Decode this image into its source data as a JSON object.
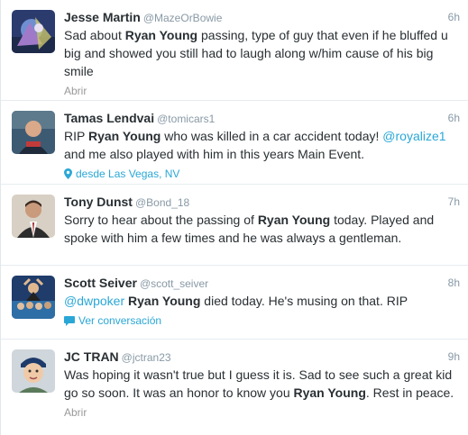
{
  "tweets": [
    {
      "fullname": "Jesse Martin",
      "username": "@MazeOrBowie",
      "time": "6h",
      "text_parts": {
        "p0": "Sad about ",
        "b0": "Ryan Young",
        "p1": " passing, type of guy that even if he bluffed u big and showed you still had to laugh along w/him cause of his big smile"
      },
      "meta": "Abrir",
      "avatar_icon": "profile-avatar-icon"
    },
    {
      "fullname": "Tamas Lendvai",
      "username": "@tomicars1",
      "time": "6h",
      "text_parts": {
        "p0": "RIP ",
        "b0": "Ryan Young",
        "p1": " who was killed in a car accident today! ",
        "m0": "@royalize1",
        "p2": " and me also played with him in this years Main Event."
      },
      "meta": "desde Las Vegas, NV",
      "meta_icon": "location-pin-icon",
      "avatar_icon": "profile-avatar-icon"
    },
    {
      "fullname": "Tony Dunst",
      "username": "@Bond_18",
      "time": "7h",
      "text_parts": {
        "p0": "Sorry to hear about the passing of ",
        "b0": "Ryan Young",
        "p1": " today. Played and spoke with him a few times and he was always a gentleman."
      },
      "avatar_icon": "profile-avatar-icon"
    },
    {
      "fullname": "Scott Seiver",
      "username": "@scott_seiver",
      "time": "8h",
      "text_parts": {
        "m0": "@dwpoker",
        "p0": " ",
        "b0": "Ryan Young",
        "p1": " died today. He's musing on that. RIP"
      },
      "meta": "Ver conversación",
      "meta_icon": "conversation-bubble-icon",
      "avatar_icon": "profile-avatar-icon"
    },
    {
      "fullname": "JC TRAN",
      "username": "@jctran23",
      "time": "9h",
      "text_parts": {
        "p0": "Was hoping it wasn't true but I guess it is. Sad to see such a great kid go so soon. It was an honor to know you ",
        "b0": "Ryan Young",
        "p1": ". Rest in peace."
      },
      "meta": "Abrir",
      "avatar_icon": "profile-avatar-icon"
    }
  ],
  "colors": {
    "link": "#2aa7d6",
    "secondary": "#8899a6",
    "text": "#292f33",
    "divider": "#e6ecf0"
  }
}
